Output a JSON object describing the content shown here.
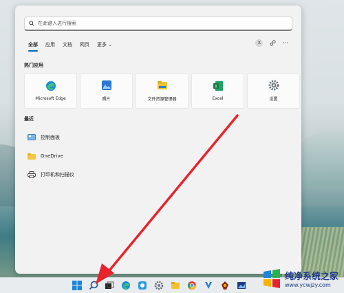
{
  "search": {
    "placeholder": "在此键入进行搜索"
  },
  "tabs": [
    "全部",
    "应用",
    "文档",
    "网页",
    "更多"
  ],
  "tab_tools": {
    "avatar_letter": "X",
    "more": "···"
  },
  "pinned": {
    "title": "热门应用",
    "apps": [
      "Microsoft Edge",
      "照片",
      "文件资源管理器",
      "Excel",
      "设置"
    ]
  },
  "recent": {
    "title": "最近",
    "items": [
      "控制面板",
      "OneDrive",
      "打印机和扫描仪"
    ]
  },
  "watermark": {
    "title": "纯净系统之家",
    "url": "www.ycwjzy.com"
  },
  "colors": {
    "accent": "#0067c0",
    "arrow": "#e8232b",
    "panel": "#f2f2f2"
  }
}
